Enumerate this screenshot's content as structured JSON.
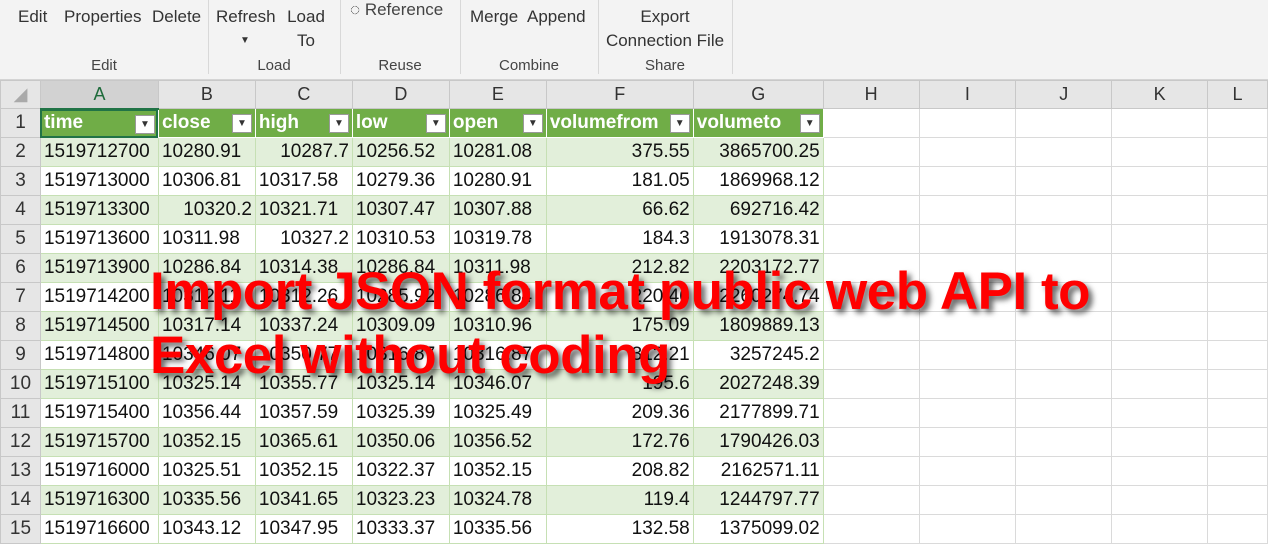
{
  "ribbon": {
    "buttons": {
      "edit": "Edit",
      "properties": "Properties",
      "delete": "Delete",
      "refresh": "Refresh",
      "load_to_1": "Load",
      "load_to_2": "To",
      "reference": "Reference",
      "merge": "Merge",
      "append": "Append",
      "export_1": "Export",
      "export_2": "Connection File"
    },
    "groups": {
      "edit": "Edit",
      "load": "Load",
      "reuse": "Reuse",
      "combine": "Combine",
      "share": "Share"
    }
  },
  "columns": [
    "A",
    "B",
    "C",
    "D",
    "E",
    "F",
    "G",
    "H",
    "I",
    "J",
    "K",
    "L"
  ],
  "table": {
    "headers": [
      "time",
      "close",
      "high",
      "low",
      "open",
      "volumefrom",
      "volumeto"
    ],
    "rows": [
      [
        "1519712700",
        "10280.91",
        "10287.7",
        "10256.52",
        "10281.08",
        "375.55",
        "3865700.25"
      ],
      [
        "1519713000",
        "10306.81",
        "10317.58",
        "10279.36",
        "10280.91",
        "181.05",
        "1869968.12"
      ],
      [
        "1519713300",
        "10320.2",
        "10321.71",
        "10307.47",
        "10307.88",
        "66.62",
        "692716.42"
      ],
      [
        "1519713600",
        "10311.98",
        "10327.2",
        "10310.53",
        "10319.78",
        "184.3",
        "1913078.31"
      ],
      [
        "1519713900",
        "10286.84",
        "10314.38",
        "10286.84",
        "10311.98",
        "212.82",
        "2203172.77"
      ],
      [
        "1519714200",
        "10312.11",
        "10312.26",
        "10285.92",
        "10286.84",
        "220.46",
        "2260274.74"
      ],
      [
        "1519714500",
        "10317.14",
        "10337.24",
        "10309.09",
        "10310.96",
        "175.09",
        "1809889.13"
      ],
      [
        "1519714800",
        "10346.07",
        "10350.77",
        "10316.87",
        "10316.87",
        "312.21",
        "3257245.2"
      ],
      [
        "1519715100",
        "10325.14",
        "10355.77",
        "10325.14",
        "10346.07",
        "195.6",
        "2027248.39"
      ],
      [
        "1519715400",
        "10356.44",
        "10357.59",
        "10325.39",
        "10325.49",
        "209.36",
        "2177899.71"
      ],
      [
        "1519715700",
        "10352.15",
        "10365.61",
        "10350.06",
        "10356.52",
        "172.76",
        "1790426.03"
      ],
      [
        "1519716000",
        "10325.51",
        "10352.15",
        "10322.37",
        "10352.15",
        "208.82",
        "2162571.11"
      ],
      [
        "1519716300",
        "10335.56",
        "10341.65",
        "10323.23",
        "10324.78",
        "119.4",
        "1244797.77"
      ],
      [
        "1519716600",
        "10343.12",
        "10347.95",
        "10333.37",
        "10335.56",
        "132.58",
        "1375099.02"
      ]
    ]
  },
  "overlay": {
    "line1": "Import JSON format public web API to",
    "line2": "Excel without coding"
  }
}
